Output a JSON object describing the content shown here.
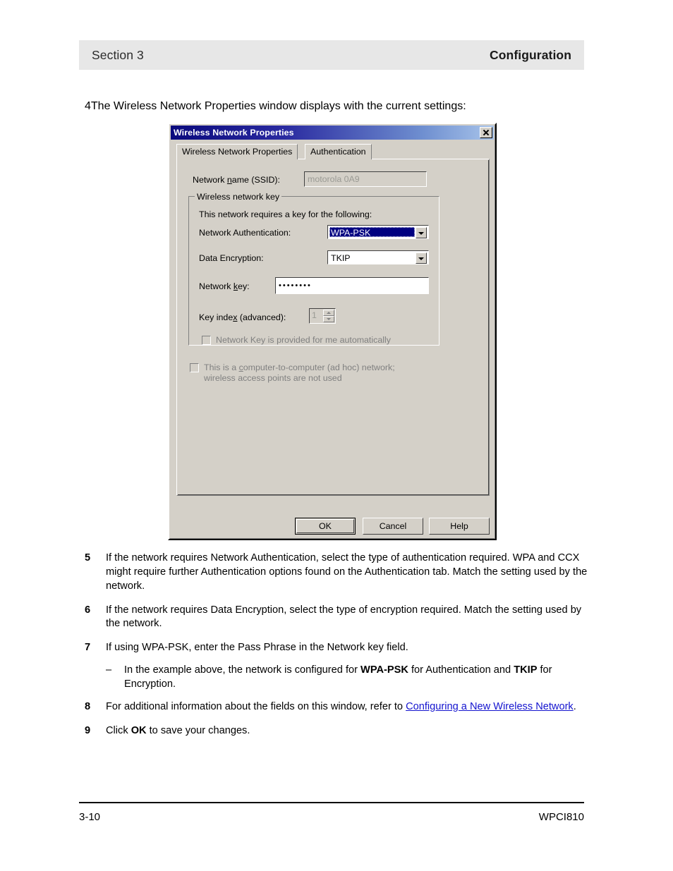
{
  "page_header": {
    "section": "Section 3",
    "title": "Configuration"
  },
  "steps": {
    "step4": {
      "num": "4",
      "text": "The Wireless Network Properties window displays with the current settings:"
    },
    "step5": {
      "num": "5",
      "text": "If the network requires Network Authentication, select the type of authentication required. WPA and CCX might require further Authentication options found on the Authentication tab. Match the setting used by the network."
    },
    "step6": {
      "num": "6",
      "text": "If the network requires Data Encryption, select the type of encryption required. Match the setting used by the network."
    },
    "step7": {
      "num": "7",
      "text": "If using WPA-PSK, enter the Pass Phrase in the Network key field.",
      "substep": {
        "dash": "–",
        "part1": "In the example above, the network is configured for ",
        "bold1": "WPA-PSK",
        "part2": " for Authentication and ",
        "bold2": "TKIP",
        "part3": " for Encryption."
      }
    },
    "step8": {
      "num": "8",
      "part1": "For additional information about the fields on this window, refer to ",
      "link": "Configuring a New Wireless Network",
      "part2": "."
    },
    "step9": {
      "num": "9",
      "part1": "Click ",
      "bold1": "OK",
      "part2": " to save your changes."
    }
  },
  "dialog": {
    "title": "Wireless Network Properties",
    "close_icon": "close-icon",
    "tabs": [
      {
        "label": "Wireless Network Properties",
        "active": true
      },
      {
        "label": "Authentication",
        "active": false
      }
    ],
    "ssid": {
      "label_pre": "Network ",
      "label_underlined": "n",
      "label_post": "ame (SSID):",
      "value": "motorola 0A9",
      "disabled": true
    },
    "key_group": {
      "legend": "Wireless network key",
      "intro": "This network requires a key for the following:",
      "auth": {
        "label": "Network Authentication:",
        "value": "WPA-PSK",
        "focused": true,
        "options": [
          "WPA-PSK"
        ]
      },
      "encryption": {
        "label": "Data Encryption:",
        "value": "TKIP",
        "options": [
          "TKIP"
        ]
      },
      "network_key": {
        "label_pre": "Network ",
        "label_underlined": "k",
        "label_post": "ey:",
        "value": "••••••••"
      },
      "key_index": {
        "label_pre": "Key inde",
        "label_underlined": "x",
        "label_post": " (advanced):",
        "value": "1",
        "disabled": true
      },
      "auto_key_checkbox": {
        "label": "Network Key is provided for me automatically",
        "checked": false,
        "disabled": true
      }
    },
    "adhoc_checkbox": {
      "line1_pre": "This is a ",
      "line1_underlined": "c",
      "line1_post": "omputer-to-computer (ad hoc) network;",
      "line2": "wireless access points are not used",
      "checked": false,
      "disabled": true
    },
    "buttons": {
      "ok": "OK",
      "cancel": "Cancel",
      "help": "Help"
    }
  },
  "footer": {
    "page_number": "3-10",
    "product": "WPCI810"
  },
  "colors": {
    "header_band": "#e7e7e7",
    "dialog_face": "#d4d0c8",
    "title_gradient_start": "#0a0a7d",
    "title_gradient_end": "#a8c4ea",
    "selection_blue": "#000080",
    "link_blue": "#1414cf",
    "disabled_text": "#808080"
  }
}
